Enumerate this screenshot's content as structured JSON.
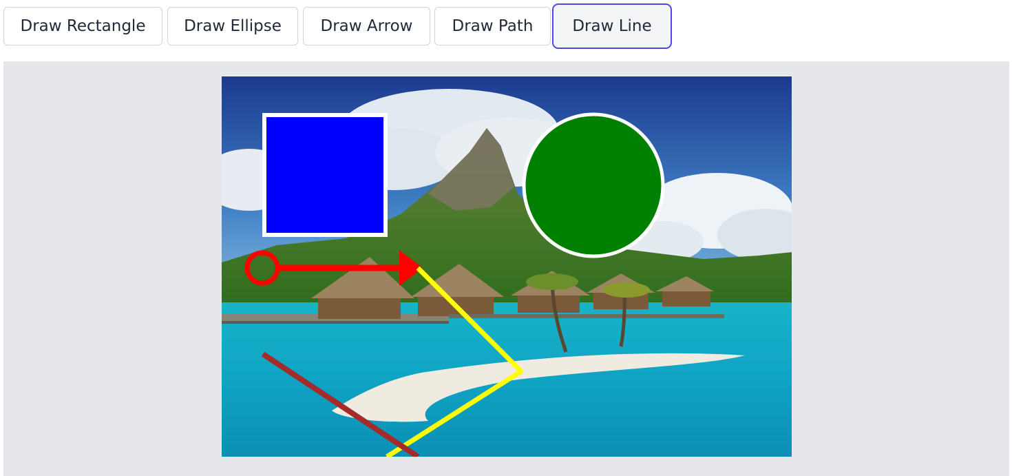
{
  "toolbar": {
    "buttons": [
      {
        "id": "rectangle",
        "label": "Draw Rectangle",
        "active": false
      },
      {
        "id": "ellipse",
        "label": "Draw Ellipse",
        "active": false
      },
      {
        "id": "arrow",
        "label": "Draw Arrow",
        "active": false
      },
      {
        "id": "path",
        "label": "Draw Path",
        "active": false
      },
      {
        "id": "line",
        "label": "Draw Line",
        "active": true
      }
    ]
  },
  "canvas": {
    "background_image": "tropical-island-overwater-bungalows-photo",
    "annotations": [
      {
        "type": "rectangle",
        "fill": "#0000ff",
        "stroke": "#ffffff"
      },
      {
        "type": "ellipse",
        "fill": "#008000",
        "stroke": "#ffffff"
      },
      {
        "type": "arrow",
        "color": "#ff0000"
      },
      {
        "type": "path",
        "color": "#ffff00"
      },
      {
        "type": "line",
        "color": "#a52a2a"
      }
    ]
  },
  "colors": {
    "active_border": "#4f46e5",
    "canvas_bg": "#e5e7eb"
  }
}
